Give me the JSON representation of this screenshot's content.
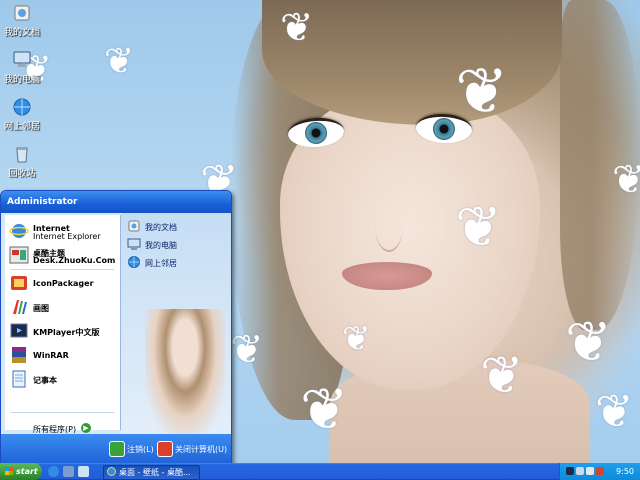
{
  "desktop": {
    "icons": [
      {
        "label": "我的文档",
        "icon": "my-documents-icon"
      },
      {
        "label": "我的电脑",
        "icon": "my-computer-icon"
      },
      {
        "label": "网上邻居",
        "icon": "network-places-icon"
      },
      {
        "label": "回收站",
        "icon": "recycle-bin-icon"
      }
    ]
  },
  "start_menu": {
    "user": "Administrator",
    "pinned": [
      {
        "title": "Internet",
        "subtitle": "Internet Explorer",
        "icon": "internet-explorer-icon"
      },
      {
        "title": "桌酷主题",
        "subtitle": "Desk.ZhuoKu.Com",
        "icon": "zhuoku-theme-icon"
      }
    ],
    "programs": [
      {
        "title": "IconPackager",
        "icon": "iconpackager-icon"
      },
      {
        "title": "画图",
        "icon": "paint-icon"
      },
      {
        "title": "KMPlayer中文版",
        "icon": "kmplayer-icon"
      },
      {
        "title": "WinRAR",
        "icon": "winrar-icon"
      },
      {
        "title": "记事本",
        "icon": "notepad-icon"
      }
    ],
    "all_programs": "所有程序(P)",
    "places": [
      {
        "label": "我的文档",
        "icon": "my-documents-icon"
      },
      {
        "label": "我的电脑",
        "icon": "my-computer-icon"
      },
      {
        "label": "网上邻居",
        "icon": "network-places-icon"
      }
    ],
    "logoff": "注销(L)",
    "shutdown": "关闭计算机(U)"
  },
  "taskbar": {
    "start_label": "start",
    "task_title": "桌面 - 壁纸 - 桌酷...",
    "clock": "9:50"
  },
  "colors": {
    "taskbar_blue": "#245edb",
    "start_green": "#3a9a3a",
    "tray_blue": "#0e8ad9"
  }
}
